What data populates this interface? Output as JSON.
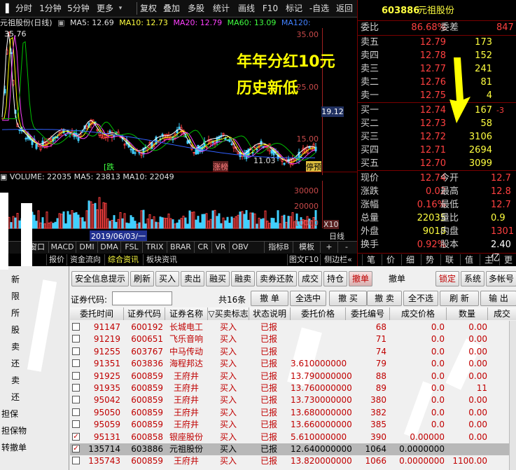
{
  "toolbar": {
    "left": [
      "分时",
      "1分钟",
      "5分钟",
      "更多"
    ],
    "right": [
      "复权",
      "叠加",
      "多股",
      "统计",
      "画线",
      "F10",
      "标记",
      "-自选",
      "返回"
    ]
  },
  "stock_header": {
    "code": "603886",
    "name": "元祖股份",
    "title": "元祖股份(日线)",
    "ma5": "MA5: 12.69",
    "ma10": "MA10: 12.73",
    "ma20": "MA20: 12.79",
    "ma60": "MA60: 13.09",
    "ma120": "MA120:"
  },
  "price_chart": {
    "high_label": "35.76",
    "low_label": "11.03",
    "current_tag": "19.12",
    "axis": [
      "35.00",
      "25.00",
      "15.00"
    ],
    "markers": [
      "涨停",
      "涨榜",
      "涨停"
    ],
    "badge_left": "[跌",
    "badge_right": "停预"
  },
  "volume_chart": {
    "line": "VOLUME: 22035  MA5: 23813  MA10: 22049",
    "axis": [
      "30000",
      "20000",
      "10000"
    ],
    "scale": "X10",
    "date_label": "2019/06/03/一"
  },
  "overlay": {
    "line1": "年年分红10元",
    "line2": "历史新低"
  },
  "bottom_tabs": [
    "窗口",
    "MACD",
    "DMI",
    "DMA",
    "FSL",
    "TRIX",
    "BRAR",
    "CR",
    "VR",
    "OBV",
    "指标B",
    "模板",
    "+",
    "-"
  ],
  "lower_tabs": [
    "报价",
    "资金流向",
    "综合资讯",
    "板块资讯",
    "图文F10",
    "侧边栏«"
  ],
  "period_label": "日线",
  "quote": {
    "weibi_label": "委比",
    "weibi_value": "86.68%",
    "weicha_label": "委差",
    "weicha_value": "847",
    "sell": [
      {
        "label": "卖五",
        "price": "12.79",
        "vol": "173"
      },
      {
        "label": "卖四",
        "price": "12.78",
        "vol": "152"
      },
      {
        "label": "卖三",
        "price": "12.77",
        "vol": "241"
      },
      {
        "label": "卖二",
        "price": "12.76",
        "vol": "81"
      },
      {
        "label": "卖一",
        "price": "12.75",
        "vol": "4"
      }
    ],
    "buy": [
      {
        "label": "买一",
        "price": "12.74",
        "vol": "167",
        "extra": "-3"
      },
      {
        "label": "买二",
        "price": "12.73",
        "vol": "58"
      },
      {
        "label": "买三",
        "price": "12.72",
        "vol": "3106"
      },
      {
        "label": "买四",
        "price": "12.71",
        "vol": "2694"
      },
      {
        "label": "买五",
        "price": "12.70",
        "vol": "3099"
      }
    ],
    "stats": [
      {
        "l1": "现价",
        "v1": "12.74",
        "l2": "今开",
        "v2": "12.7"
      },
      {
        "l1": "涨跌",
        "v1": "0.02",
        "l2": "最高",
        "v2": "12.8"
      },
      {
        "l1": "涨幅",
        "v1": "0.16%",
        "l2": "最低",
        "v2": "12.7"
      },
      {
        "l1": "总量",
        "v1": "22035",
        "l2": "量比",
        "v2": "0.9"
      },
      {
        "l1": "外盘",
        "v1": "9018",
        "l2": "内盘",
        "v2": "1301"
      },
      {
        "l1": "换手",
        "v1": "0.92%",
        "l2": "股本",
        "v2": "2.40亿"
      }
    ],
    "tabs": [
      "笔",
      "价",
      "细",
      "势",
      "联",
      "值",
      "主",
      "更"
    ]
  },
  "order_panel": {
    "mode_tabs": [
      "撤单"
    ],
    "mode_title": "撤单",
    "top_buttons": [
      "安全信息提示",
      "刷新",
      "买入",
      "卖出",
      "融买",
      "融卖",
      "卖券还款",
      "成交",
      "持仓",
      "撤单"
    ],
    "right_buttons": [
      "锁定",
      "系统",
      "多帐号"
    ],
    "code_label": "证券代码:",
    "count_label": "共16条",
    "action_buttons": [
      "撤 单",
      "全选中",
      "撤 买",
      "撤 卖",
      "全不选",
      "刷 新",
      "输 出"
    ],
    "columns": [
      "委托时间",
      "证券代码",
      "证券名称",
      "▽买卖标志",
      "状态说明",
      "委托价格",
      "委托编号",
      "成交价格",
      "数量",
      "成交"
    ],
    "rows": [
      {
        "checked": false,
        "time": "91147",
        "code": "600192",
        "name": "长城电工",
        "side": "买入",
        "status": "已报",
        "price": "",
        "no": "68",
        "deal": "0.0",
        "qty": "0.00"
      },
      {
        "checked": false,
        "time": "91219",
        "code": "600651",
        "name": "飞乐音响",
        "side": "买入",
        "status": "已报",
        "price": "",
        "no": "71",
        "deal": "0.0",
        "qty": "0.00"
      },
      {
        "checked": false,
        "time": "91255",
        "code": "603767",
        "name": "中马传动",
        "side": "买入",
        "status": "已报",
        "price": "",
        "no": "74",
        "deal": "0.0",
        "qty": "0.00"
      },
      {
        "checked": false,
        "time": "91351",
        "code": "603836",
        "name": "海程邦达",
        "side": "买入",
        "status": "已报",
        "price": "3.610000000",
        "no": "79",
        "deal": "0.0",
        "qty": "0.00"
      },
      {
        "checked": false,
        "time": "91925",
        "code": "600859",
        "name": "王府井",
        "side": "买入",
        "status": "已报",
        "price": "13.790000000",
        "no": "88",
        "deal": "0.0",
        "qty": "0.00"
      },
      {
        "checked": false,
        "time": "91935",
        "code": "600859",
        "name": "王府井",
        "side": "买入",
        "status": "已报",
        "price": "13.760000000",
        "no": "89",
        "deal": "0.0",
        "qty": "11"
      },
      {
        "checked": false,
        "time": "95042",
        "code": "600859",
        "name": "王府井",
        "side": "买入",
        "status": "已报",
        "price": "13.730000000",
        "no": "380",
        "deal": "0.0",
        "qty": "0.00"
      },
      {
        "checked": false,
        "time": "95050",
        "code": "600859",
        "name": "王府井",
        "side": "买入",
        "status": "已报",
        "price": "13.680000000",
        "no": "382",
        "deal": "0.0",
        "qty": "0.00"
      },
      {
        "checked": false,
        "time": "95059",
        "code": "600859",
        "name": "王府井",
        "side": "买入",
        "status": "已报",
        "price": "13.660000000",
        "no": "385",
        "deal": "0.0",
        "qty": "0.00"
      },
      {
        "checked": true,
        "time": "95131",
        "code": "600858",
        "name": "银座股份",
        "side": "买入",
        "status": "已报",
        "price": "5.610000000",
        "no": "390",
        "deal": "0.00000",
        "qty": "0.00"
      },
      {
        "checked": true,
        "time": "135714",
        "code": "603886",
        "name": "元祖股份",
        "side": "买入",
        "status": "已报",
        "price": "12.640000000",
        "no": "1064",
        "deal": "0.0000000",
        "qty": "",
        "selected": true
      },
      {
        "checked": false,
        "time": "135743",
        "code": "600859",
        "name": "王府井",
        "side": "买入",
        "status": "已报",
        "price": "13.820000000",
        "no": "1066",
        "deal": "0.0000000",
        "qty": "1100.00"
      }
    ]
  },
  "left_sidebar": [
    "新",
    "限",
    "所",
    "股",
    "卖",
    "还",
    "卖",
    "还",
    "担保",
    "担保物",
    "转撤单"
  ],
  "colors": {
    "up": "#ff4040",
    "vol": "#ffff40",
    "accent": "#c00000",
    "bg": "#000000"
  }
}
